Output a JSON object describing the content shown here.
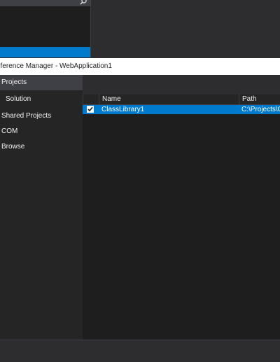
{
  "dialog": {
    "title": "eference Manager - WebApplication1"
  },
  "sidebar": {
    "items": [
      {
        "label": "Projects"
      },
      {
        "label": "Solution"
      },
      {
        "label": "Shared Projects"
      },
      {
        "label": "COM"
      },
      {
        "label": "Browse"
      }
    ]
  },
  "grid": {
    "columns": [
      {
        "label": "Name"
      },
      {
        "label": "Path"
      }
    ],
    "rows": [
      {
        "checked": true,
        "name": "ClassLibrary1",
        "path": "C:\\Projects\\C"
      }
    ]
  },
  "colors": {
    "accent": "#007acc",
    "background": "#2d2d30",
    "panel": "#252526",
    "grid_bg": "#1e1e1e"
  },
  "icons": {
    "background_search": "search-icon",
    "row_check": "checkmark-icon"
  }
}
